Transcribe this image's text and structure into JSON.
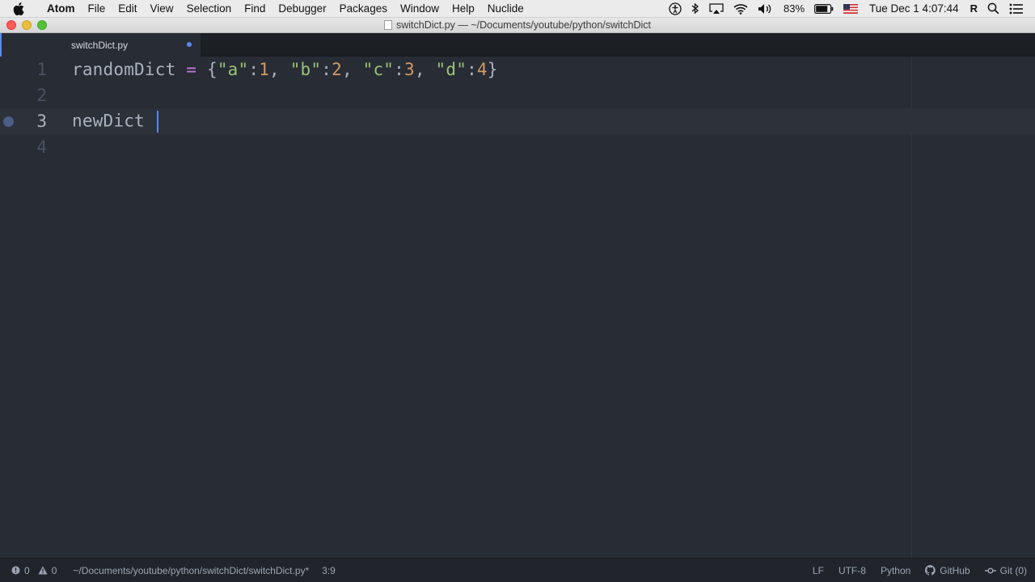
{
  "menubar": {
    "items": [
      "Atom",
      "File",
      "Edit",
      "View",
      "Selection",
      "Find",
      "Debugger",
      "Packages",
      "Window",
      "Help",
      "Nuclide"
    ],
    "battery": "83%",
    "clock": "Tue Dec 1  4:07:44",
    "user_initial": "R"
  },
  "window": {
    "title": "switchDict.py — ~/Documents/youtube/python/switchDict"
  },
  "tab": {
    "label": "switchDict.py"
  },
  "editor": {
    "lines": [
      {
        "number": "1"
      },
      {
        "number": "2"
      },
      {
        "number": "3"
      },
      {
        "number": "4"
      }
    ],
    "line1": {
      "var": "randomDict",
      "op": "=",
      "open": "{",
      "k1": "\"a\"",
      "c1": ":",
      "v1": "1",
      "s1": ",",
      "k2": "\"b\"",
      "c2": ":",
      "v2": "2",
      "s2": ",",
      "k3": "\"c\"",
      "c3": ":",
      "v3": "3",
      "s3": ",",
      "k4": "\"d\"",
      "c4": ":",
      "v4": "4",
      "close": "}"
    },
    "line3": {
      "text": "newDict "
    }
  },
  "statusbar": {
    "errors": "0",
    "warnings": "0",
    "path": "~/Documents/youtube/python/switchDict/switchDict.py*",
    "cursor_pos": "3:9",
    "line_ending": "LF",
    "encoding": "UTF-8",
    "grammar": "Python",
    "github": "GitHub",
    "git": "Git (0)"
  },
  "colors": {
    "accent": "#568af2",
    "editor_bg": "#282c34",
    "string": "#98c379",
    "number": "#d19a66",
    "operator": "#c678dd"
  }
}
